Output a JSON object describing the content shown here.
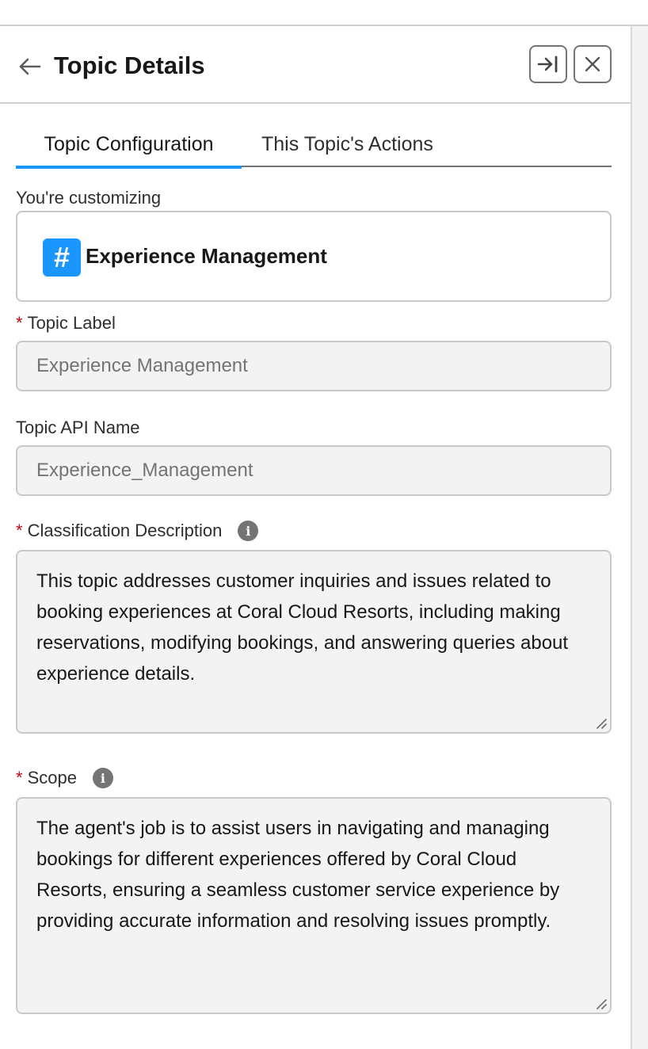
{
  "header": {
    "title": "Topic Details",
    "back_icon": "arrow-left-icon",
    "collapse_icon": "collapse-right-icon",
    "close_icon": "close-icon"
  },
  "tabs": [
    {
      "label": "Topic Configuration",
      "active": true
    },
    {
      "label": "This Topic's Actions",
      "active": false
    }
  ],
  "customizing": {
    "label": "You're customizing",
    "icon": "hash-icon",
    "icon_glyph": "#",
    "topic_name": "Experience Management",
    "icon_color": "#1b96ff"
  },
  "topic_label": {
    "label": "Topic Label",
    "required_mark": "*",
    "value": "Experience Management"
  },
  "api_name": {
    "label": "Topic API Name",
    "value": "Experience_Management"
  },
  "classification": {
    "label": "Classification Description",
    "required_mark": "*",
    "info_glyph": "i",
    "value": "This topic addresses customer inquiries and issues related to booking experiences at Coral Cloud Resorts, including making reservations, modifying bookings, and answering queries about experience details."
  },
  "scope": {
    "label": "Scope",
    "required_mark": "*",
    "info_glyph": "i",
    "value": "The agent's job is to assist users in navigating and managing bookings for different experiences offered by Coral Cloud Resorts, ensuring a seamless customer service experience by providing accurate information and resolving issues promptly."
  },
  "colors": {
    "accent": "#1b96ff",
    "required": "#ba0517",
    "field_bg": "#f3f3f3",
    "border": "#c9c9c9"
  }
}
